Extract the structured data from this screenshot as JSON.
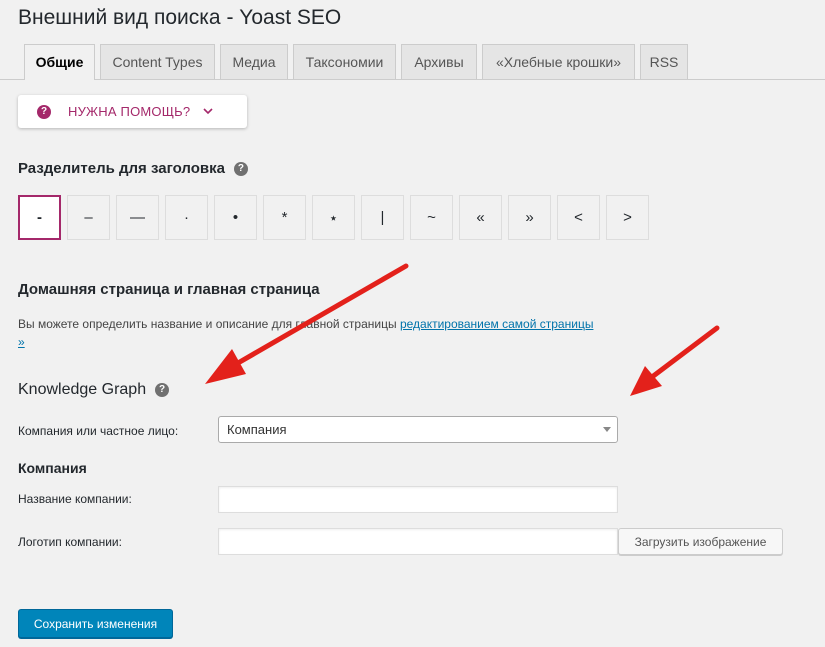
{
  "page": {
    "title": "Внешний вид поиска - Yoast SEO"
  },
  "tabs": [
    {
      "label": "Общие",
      "active": true
    },
    {
      "label": "Content Types",
      "active": false
    },
    {
      "label": "Медиа",
      "active": false
    },
    {
      "label": "Таксономии",
      "active": false
    },
    {
      "label": "Архивы",
      "active": false
    },
    {
      "label": "«Хлебные крошки»",
      "active": false
    },
    {
      "label": "RSS",
      "active": false
    }
  ],
  "help": {
    "icon": "question-icon",
    "label": "НУЖНА ПОМОЩЬ?",
    "accent": "#a4286a"
  },
  "separator": {
    "heading": "Разделитель для заголовка",
    "options": [
      "-",
      "–",
      "—",
      "·",
      "•",
      "*",
      "⋆",
      "|",
      "~",
      "«",
      "»",
      "<",
      ">"
    ],
    "selected": "-"
  },
  "homepage": {
    "heading": "Домашняя страница и главная страница",
    "text_before_link": "Вы можете определить название и описание для главной страницы ",
    "link_text": "редактированием самой страницы »"
  },
  "knowledge_graph": {
    "heading": "Knowledge Graph",
    "type_label": "Компания или частное лицо:",
    "type_value": "Компания",
    "company_heading": "Компания",
    "name_label": "Название компании:",
    "name_value": "",
    "logo_label": "Логотип компании:",
    "logo_value": "",
    "upload_label": "Загрузить изображение"
  },
  "save_label": "Сохранить изменения",
  "colors": {
    "accent": "#a4286a",
    "primary": "#0085ba",
    "link": "#0073aa",
    "arrow": "#e3211b"
  }
}
